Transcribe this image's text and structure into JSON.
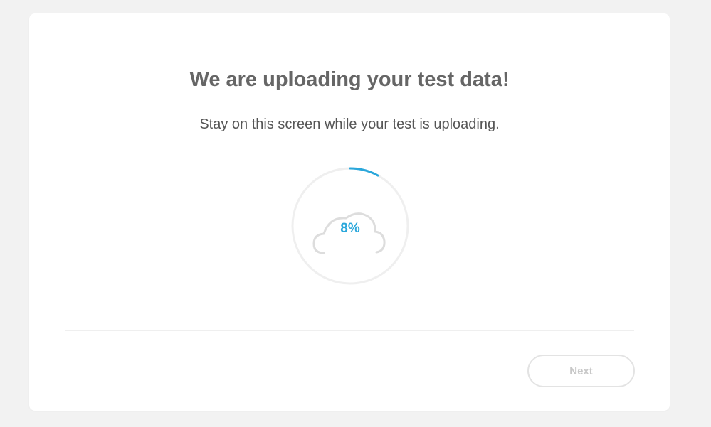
{
  "upload": {
    "title": "We are uploading your test data!",
    "subtitle": "Stay on this screen while your test is uploading.",
    "progress_percent": 8,
    "progress_label": "8%",
    "icon": "cloud-icon"
  },
  "footer": {
    "next_label": "Next"
  },
  "colors": {
    "accent": "#2aa7db",
    "title": "#666666",
    "text": "#555555",
    "ring_track": "#efefef",
    "cloud_stroke": "#dddddd",
    "button_border": "#e3e3e3",
    "button_text": "#c8c8c8",
    "background": "#f2f2f2",
    "card": "#ffffff"
  }
}
